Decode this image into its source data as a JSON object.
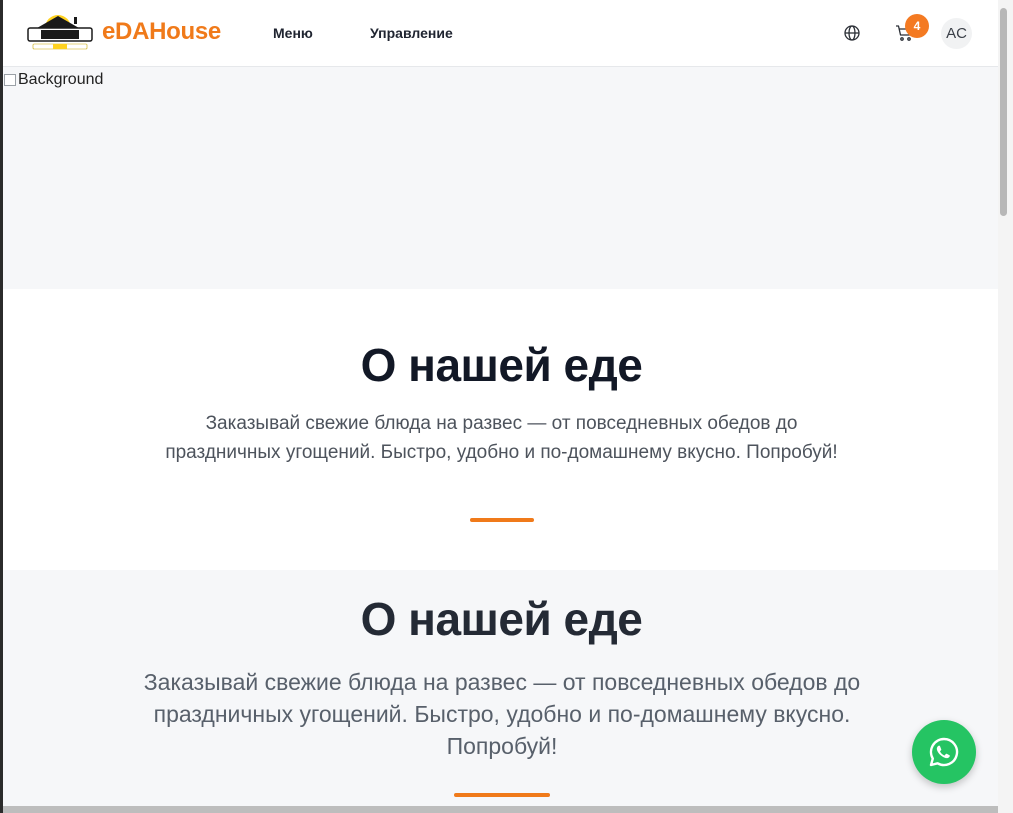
{
  "header": {
    "brand": "eDAHouse",
    "nav": [
      {
        "label": "Меню"
      },
      {
        "label": "Управление"
      }
    ],
    "cart_count": "4",
    "avatar_initials": "AC"
  },
  "hero": {
    "image_alt": "Background"
  },
  "about": {
    "title": "О нашей еде",
    "text": "Заказывай свежие блюда на развес — от повседневных обедов до праздничных угощений. Быстро, удобно и по-домашнему вкусно. Попробуй!"
  },
  "about_repeat": {
    "title": "О нашей еде",
    "text": "Заказывай свежие блюда на развес — от повседневных обедов до праздничных угощений. Быстро, удобно и по-домашнему вкусно. Попробуй!"
  },
  "colors": {
    "brand_orange": "#f07a1a",
    "whatsapp_green": "#25c463"
  },
  "icons": {
    "globe": "globe-icon",
    "cart": "cart-icon",
    "whatsapp": "whatsapp-icon"
  }
}
